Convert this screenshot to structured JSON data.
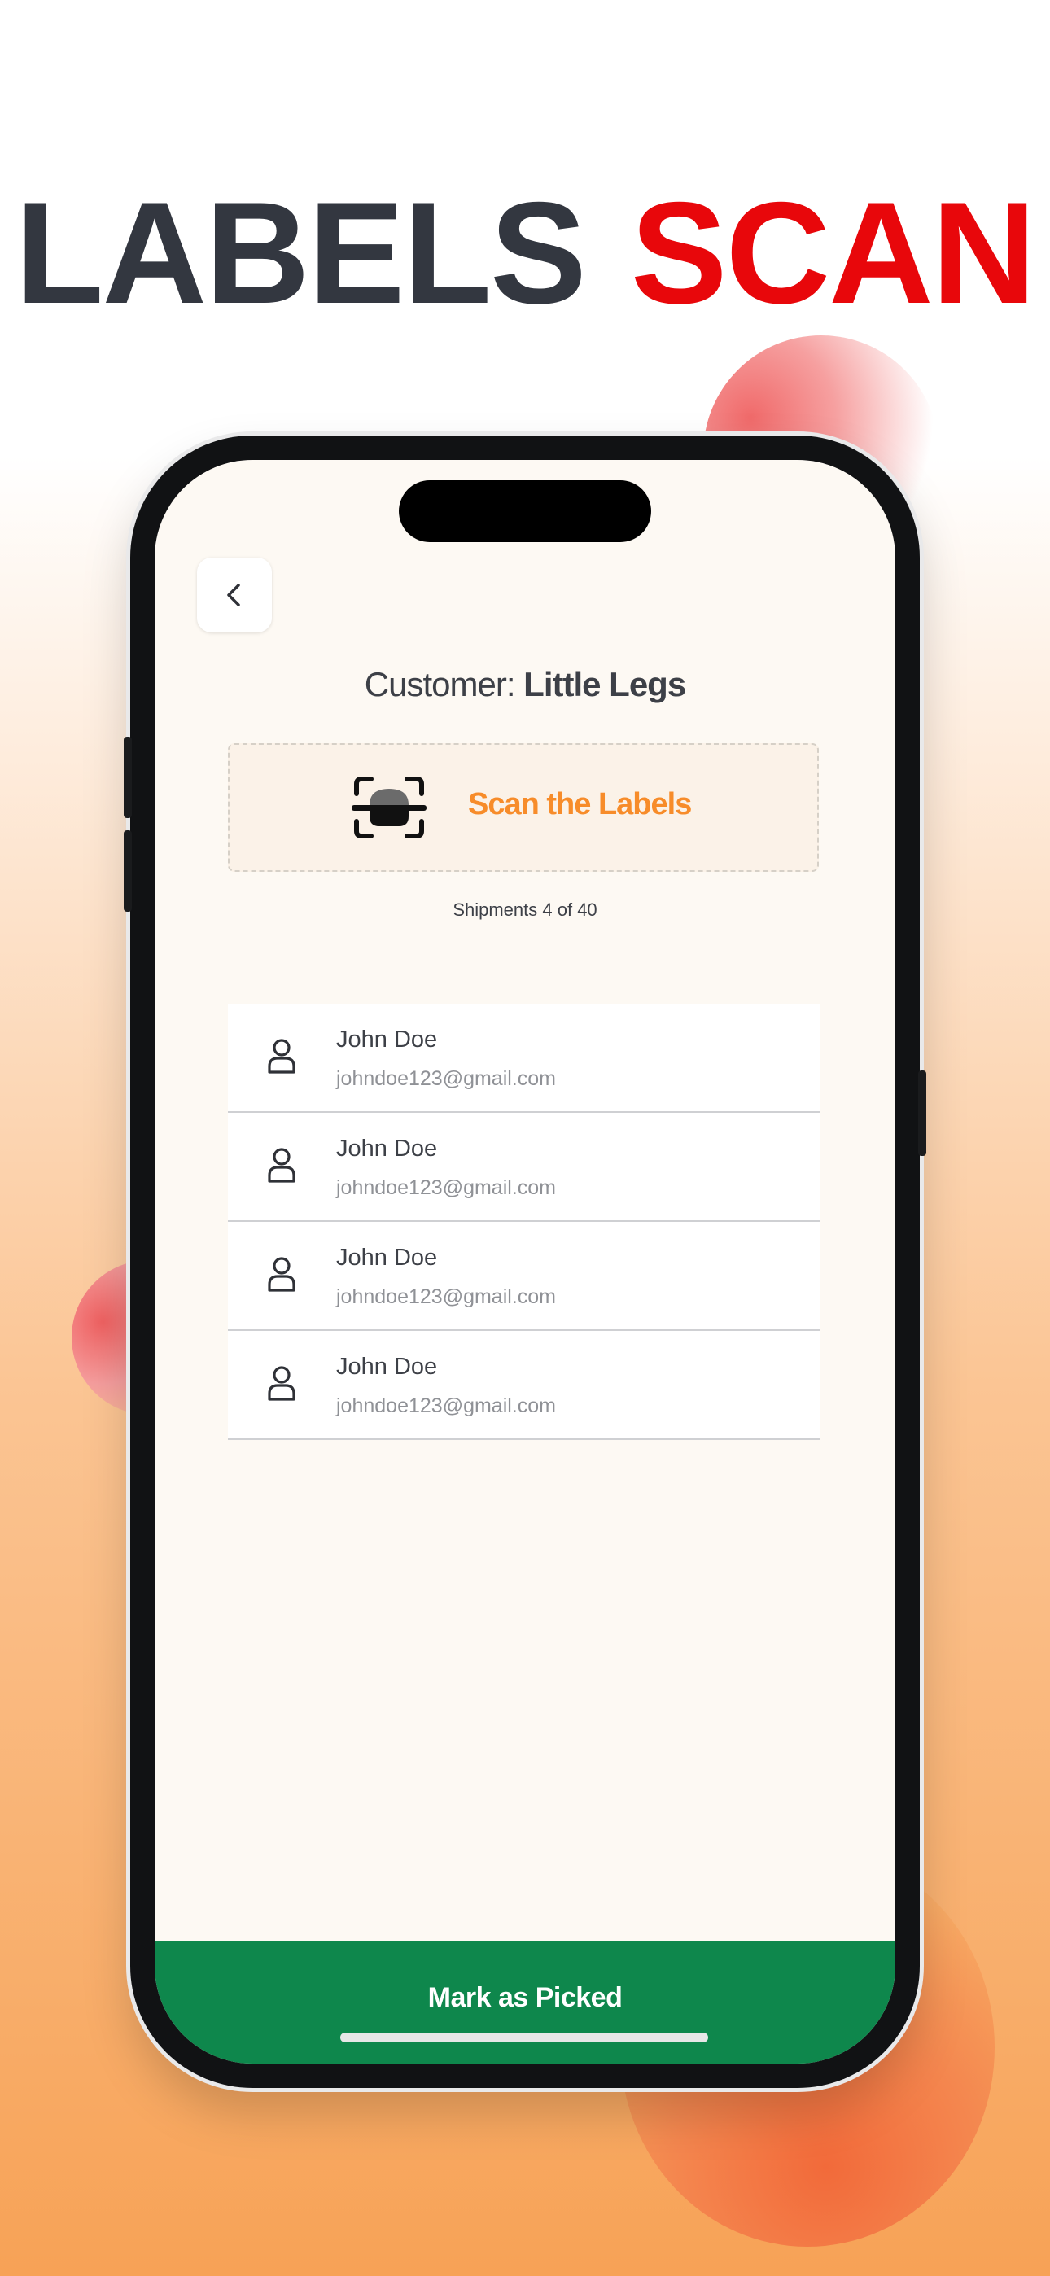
{
  "headline": {
    "word1": "LABELS",
    "word2": "SCAN"
  },
  "colors": {
    "headline_dark": "#333740",
    "headline_red": "#e8070b",
    "accent_orange": "#f78c2a",
    "primary_green": "#0e874c"
  },
  "screen": {
    "back_icon": "chevron-left-icon",
    "customer_prefix": "Customer:",
    "customer_name": "Little Legs",
    "scan": {
      "icon": "scan-label-icon",
      "label": "Scan the Labels"
    },
    "shipments_text": "Shipments 4 of 40",
    "contacts": [
      {
        "name": "John Doe",
        "email": "johndoe123@gmail.com",
        "icon": "user-icon"
      },
      {
        "name": "John Doe",
        "email": "johndoe123@gmail.com",
        "icon": "user-icon"
      },
      {
        "name": "John Doe",
        "email": "johndoe123@gmail.com",
        "icon": "user-icon"
      },
      {
        "name": "John Doe",
        "email": "johndoe123@gmail.com",
        "icon": "user-icon"
      }
    ],
    "primary_action": "Mark as Picked"
  }
}
